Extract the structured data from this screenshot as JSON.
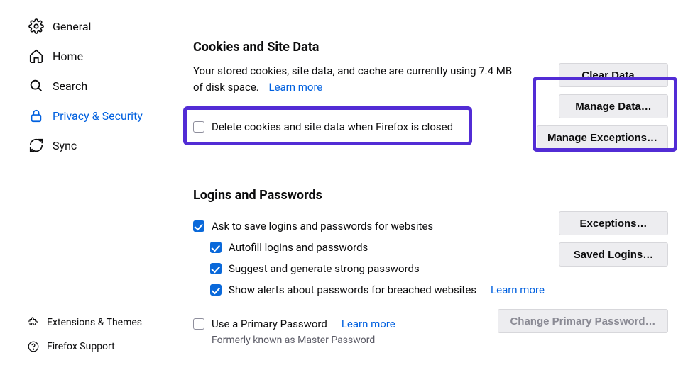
{
  "sidebar": {
    "items": [
      {
        "label": "General"
      },
      {
        "label": "Home"
      },
      {
        "label": "Search"
      },
      {
        "label": "Privacy & Security"
      },
      {
        "label": "Sync"
      }
    ],
    "footer": [
      {
        "label": "Extensions & Themes"
      },
      {
        "label": "Firefox Support"
      }
    ]
  },
  "cookies": {
    "heading": "Cookies and Site Data",
    "desc1": "Your stored cookies, site data, and cache are currently using 7.4 MB of disk space.",
    "learn_more": "Learn more",
    "delete_when_closed": "Delete cookies and site data when Firefox is closed",
    "buttons": {
      "clear_data": "Clear Data…",
      "manage_data": "Manage Data…",
      "manage_exceptions": "Manage Exceptions…"
    }
  },
  "logins": {
    "heading": "Logins and Passwords",
    "ask_save": "Ask to save logins and passwords for websites",
    "autofill": "Autofill logins and passwords",
    "suggest": "Suggest and generate strong passwords",
    "breach_alerts": "Show alerts about passwords for breached websites",
    "breach_learn_more": "Learn more",
    "primary_password": "Use a Primary Password",
    "primary_learn_more": "Learn more",
    "primary_hint": "Formerly known as Master Password",
    "buttons": {
      "exceptions": "Exceptions…",
      "saved_logins": "Saved Logins…",
      "change_primary": "Change Primary Password…"
    }
  }
}
